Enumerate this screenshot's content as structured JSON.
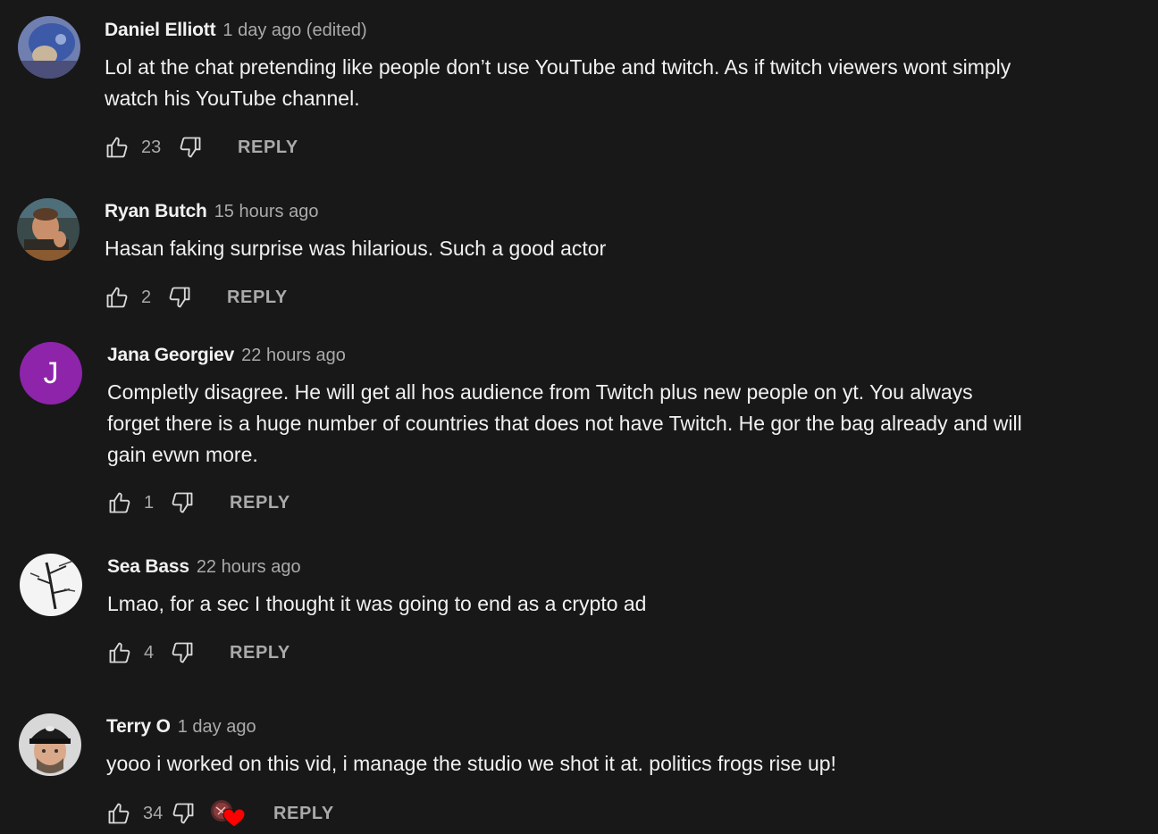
{
  "colors": {
    "background": "#181818",
    "text": "#f1f1f1",
    "muted": "#aaaaaa",
    "jana_avatar": "#8e24aa",
    "heart": "#ff0000"
  },
  "icons": {
    "like": "thumbs-up-icon",
    "dislike": "thumbs-down-icon",
    "creator_heart": "creator-heart-icon"
  },
  "comments": [
    {
      "author": "Daniel Elliott",
      "time": "1 day ago (edited)",
      "text_lines": [
        "Lol at the chat pretending like people don’t use YouTube and twitch. As if twitch viewers wont simply",
        "watch his YouTube channel."
      ],
      "likes": "23",
      "reply": "REPLY"
    },
    {
      "author": "Ryan Butch",
      "time": "15 hours ago",
      "text_lines": [
        "Hasan faking surprise was hilarious. Such a good actor"
      ],
      "likes": "2",
      "reply": "REPLY"
    },
    {
      "author": "Jana Georgiev",
      "time": "22 hours ago",
      "avatar_letter": "J",
      "text_lines": [
        "Completly disagree. He will get all hos audience from Twitch plus new people on yt. You always",
        "forget there is a huge number of countries that does not have Twitch. He gor the bag already and will",
        "gain evwn more."
      ],
      "likes": "1",
      "reply": "REPLY"
    },
    {
      "author": "Sea Bass",
      "time": "22 hours ago",
      "text_lines": [
        "Lmao, for a sec I thought it was going to end as a crypto ad"
      ],
      "likes": "4",
      "reply": "REPLY"
    },
    {
      "author": "Terry O",
      "time": "1 day ago",
      "text_lines": [
        "yooo i worked on this vid, i manage the studio we shot it at. politics frogs rise up!"
      ],
      "likes": "34",
      "reply": "REPLY",
      "creator_hearted": true
    }
  ]
}
